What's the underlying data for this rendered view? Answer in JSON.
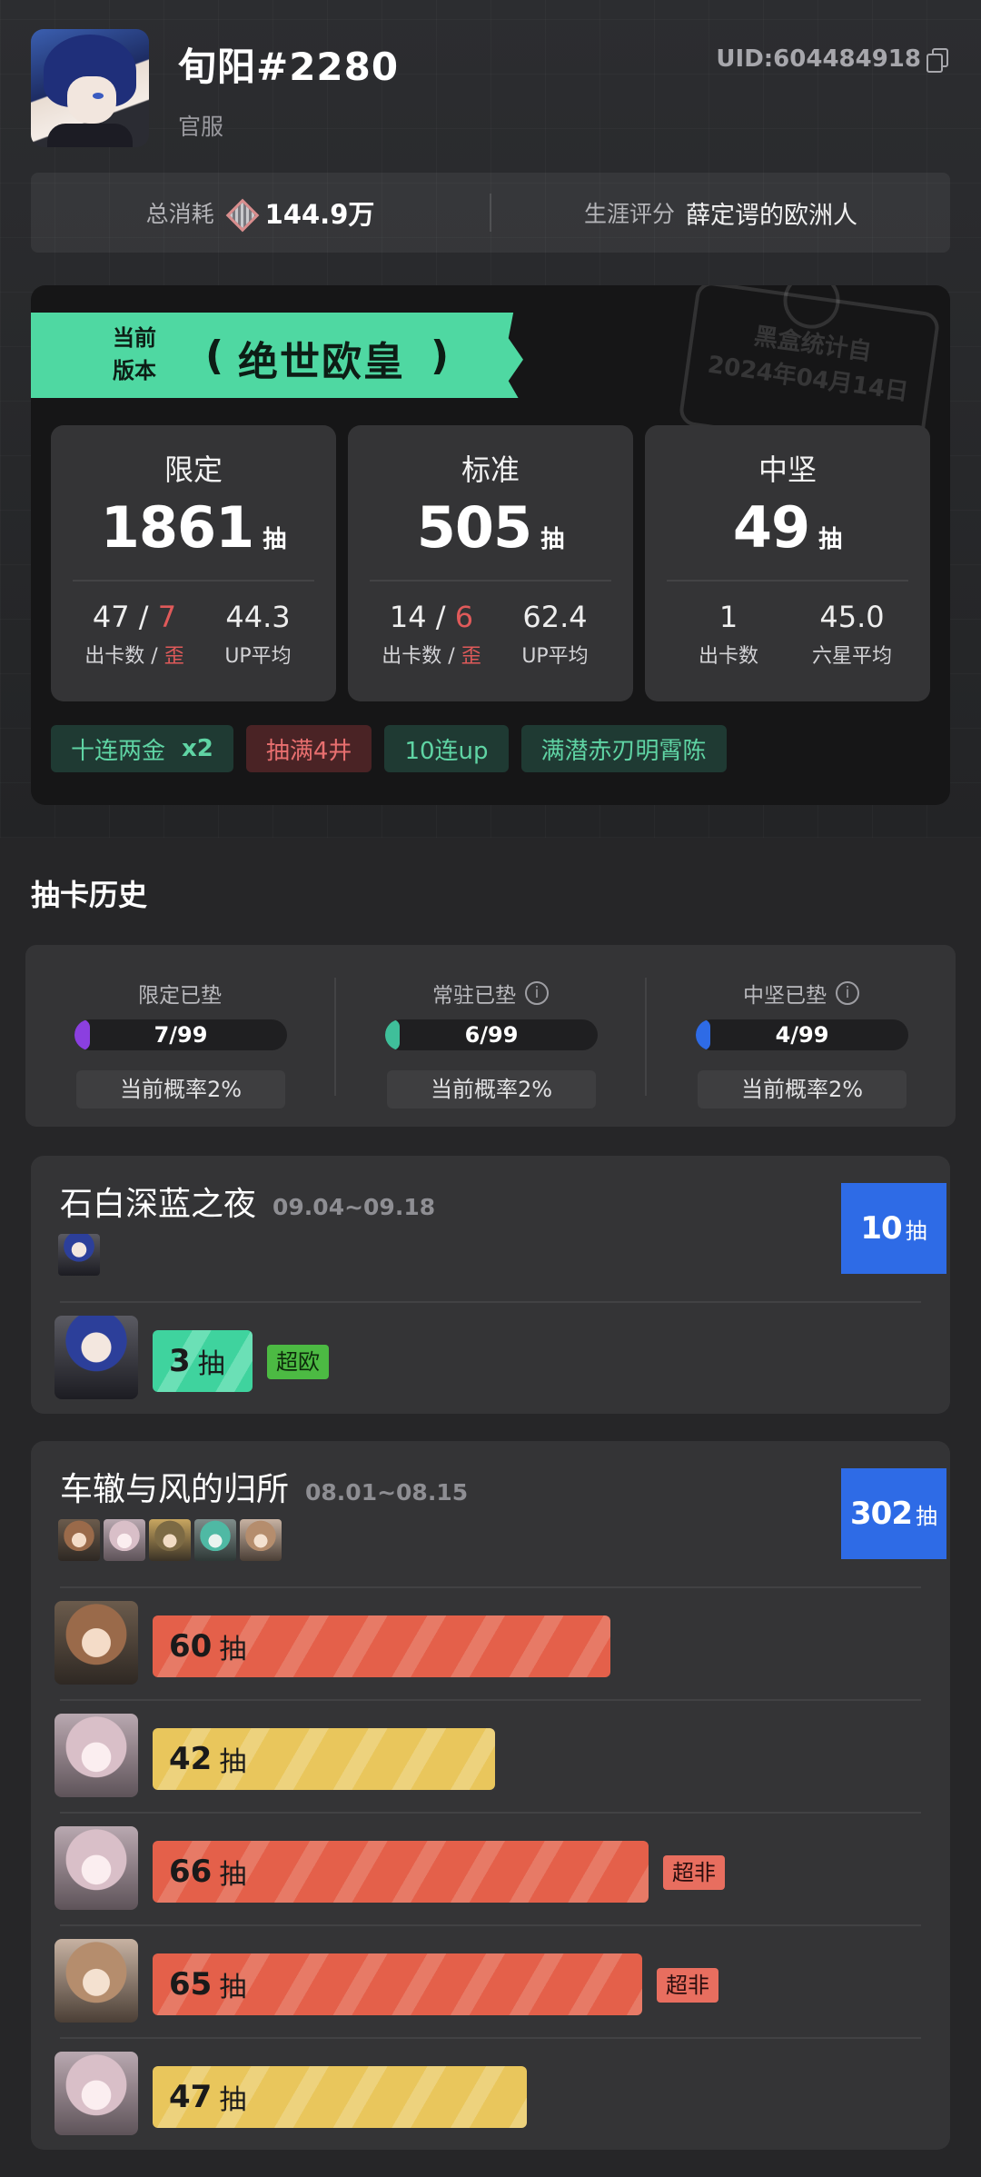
{
  "profile": {
    "username": "旬阳#2280",
    "server": "官服",
    "uid": "UID:604484918"
  },
  "stats": {
    "total_label": "总消耗",
    "total_value": "144.9万",
    "rating_label": "生涯评分",
    "rating_value": "薛定谔的欧洲人"
  },
  "summary": {
    "ribbon_line1": "当前",
    "ribbon_line2": "版本",
    "ribbon_title": "绝世欧皇",
    "stamp_line1": "黑盒统计自",
    "stamp_line2": "2024年04月14日",
    "boxes": [
      {
        "title": "限定",
        "count": "1861",
        "unit": "抽",
        "left_value_a": "47 / ",
        "left_value_b": "7",
        "left_label_a": "出卡数 / ",
        "left_label_b": "歪",
        "right_value": "44.3",
        "right_label": "UP平均"
      },
      {
        "title": "标准",
        "count": "505",
        "unit": "抽",
        "left_value_a": "14 / ",
        "left_value_b": "6",
        "left_label_a": "出卡数 / ",
        "left_label_b": "歪",
        "right_value": "62.4",
        "right_label": "UP平均"
      },
      {
        "title": "中坚",
        "count": "49",
        "unit": "抽",
        "left_value_a": "1",
        "left_value_b": "",
        "left_label_a": "出卡数",
        "left_label_b": "",
        "right_value": "45.0",
        "right_label": "六星平均"
      }
    ],
    "tags": [
      {
        "text": "十连两金",
        "extra": "x2",
        "style": "green"
      },
      {
        "text": "抽满4井",
        "extra": "",
        "style": "red"
      },
      {
        "text": "10连up",
        "extra": "",
        "style": "green"
      },
      {
        "text": "满潜赤刃明霄陈",
        "extra": "",
        "style": "green"
      }
    ]
  },
  "history": {
    "title": "抽卡历史",
    "pity": [
      {
        "label": "限定已垫",
        "info": false,
        "value": "7/99",
        "fraction": 0.0707,
        "color": "#8b3fe0",
        "rate": "当前概率2%"
      },
      {
        "label": "常驻已垫",
        "info": true,
        "value": "6/99",
        "fraction": 0.0606,
        "color": "#3fbf9a",
        "rate": "当前概率2%"
      },
      {
        "label": "中坚已垫",
        "info": true,
        "value": "4/99",
        "fraction": 0.0404,
        "color": "#2e6be6",
        "rate": "当前概率2%"
      }
    ],
    "banners": [
      {
        "name": "石白深蓝之夜",
        "date": "09.04~09.18",
        "count": "10",
        "unit": "抽",
        "pulls": [
          {
            "count": "3",
            "unit": "抽",
            "color": "green",
            "fraction": 0.04,
            "badge": "超欧",
            "badge_type": "good",
            "avatar": "blue"
          }
        ]
      },
      {
        "name": "车辙与风的归所",
        "date": "08.01~08.15",
        "count": "302",
        "unit": "抽",
        "pulls": [
          {
            "count": "60",
            "unit": "抽",
            "color": "red",
            "fraction": 0.6,
            "badge": "",
            "badge_type": "",
            "avatar": "brown"
          },
          {
            "count": "42",
            "unit": "抽",
            "color": "yellow",
            "fraction": 0.42,
            "badge": "",
            "badge_type": "",
            "avatar": "pink"
          },
          {
            "count": "66",
            "unit": "抽",
            "color": "red",
            "fraction": 0.66,
            "badge": "超非",
            "badge_type": "bad",
            "avatar": "pink"
          },
          {
            "count": "65",
            "unit": "抽",
            "color": "red",
            "fraction": 0.65,
            "badge": "超非",
            "badge_type": "bad",
            "avatar": "tan"
          },
          {
            "count": "47",
            "unit": "抽",
            "color": "yellow",
            "fraction": 0.47,
            "badge": "",
            "badge_type": "",
            "avatar": "pink"
          }
        ]
      }
    ]
  }
}
